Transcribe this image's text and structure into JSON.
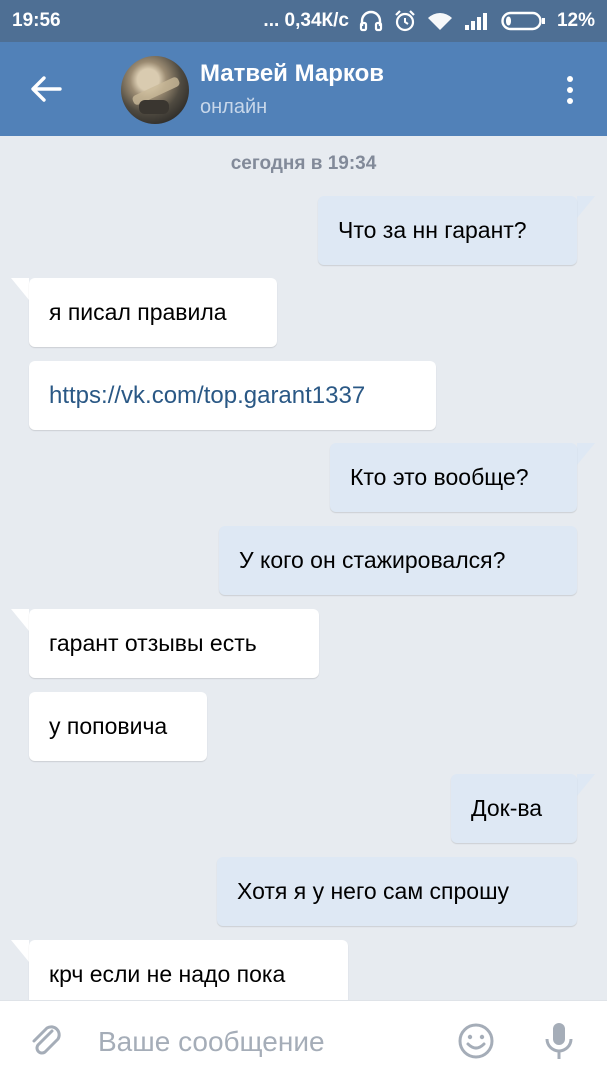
{
  "status_bar": {
    "time": "19:56",
    "network_speed": "... 0,34К/с",
    "battery": "12%",
    "icons": [
      "headphones-icon",
      "alarm-icon",
      "wifi-icon",
      "signal-icon",
      "battery-icon"
    ]
  },
  "header": {
    "contact_name": "Матвей Марков",
    "contact_status": "онлайн"
  },
  "chat": {
    "date_separator": "сегодня в 19:34",
    "messages": [
      {
        "dir": "out",
        "text": "Что за нн гарант?"
      },
      {
        "dir": "in",
        "text": "я писал правила"
      },
      {
        "dir": "in",
        "text": "https://vk.com/top.garant1337",
        "link": true
      },
      {
        "dir": "out",
        "text": "Кто это вообще?"
      },
      {
        "dir": "out",
        "text": "У кого он стажировался?"
      },
      {
        "dir": "in",
        "text": "гарант отзывы есть"
      },
      {
        "dir": "in",
        "text": "у поповича"
      },
      {
        "dir": "out",
        "text": "Док-ва"
      },
      {
        "dir": "out",
        "text": "Хотя я у него сам спрошу"
      },
      {
        "dir": "in",
        "text": "крч если не надо пока"
      }
    ]
  },
  "composer": {
    "placeholder": "Ваше сообщение"
  },
  "colors": {
    "status_bar": "#4e6f94",
    "header": "#5181b8",
    "chat_bg": "#e7ebf0",
    "outgoing_bubble": "#dee8f4",
    "incoming_bubble": "#ffffff",
    "link": "#2a5885"
  }
}
